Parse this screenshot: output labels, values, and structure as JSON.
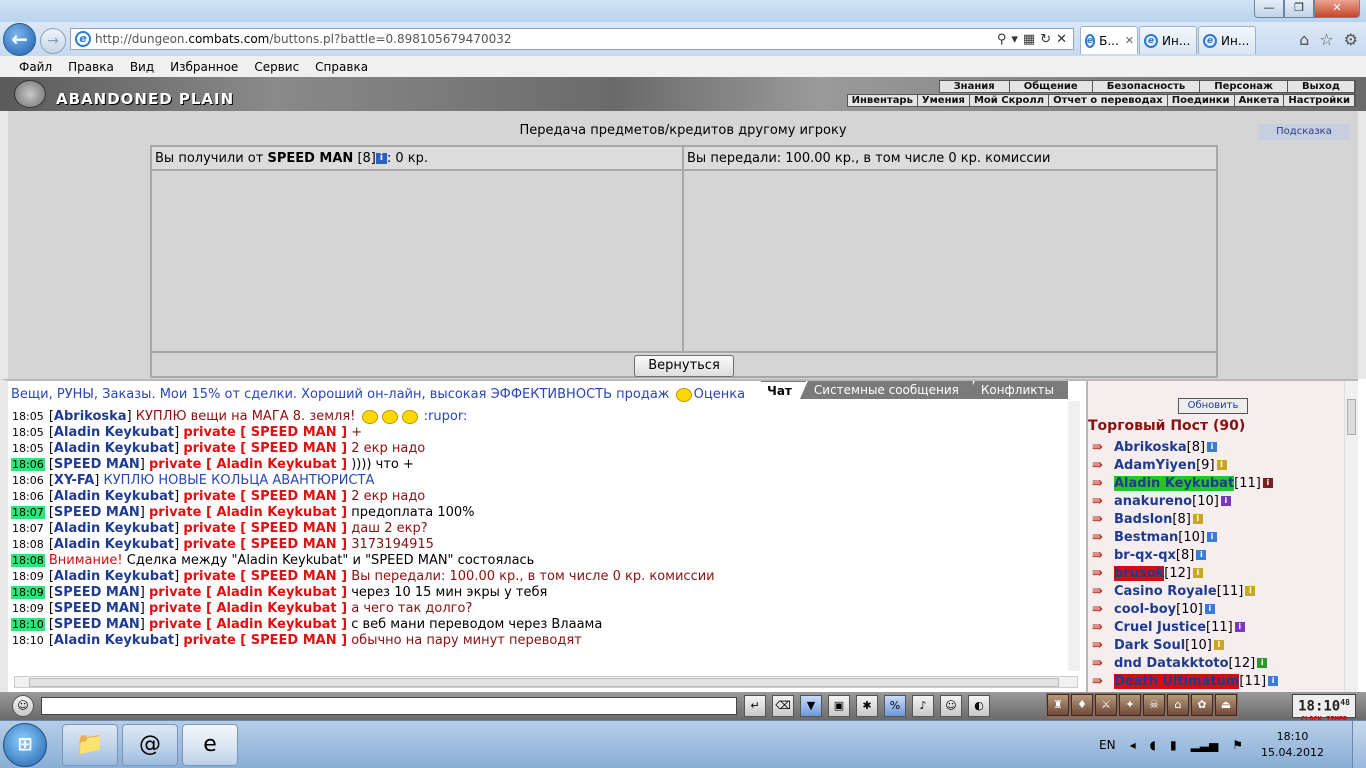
{
  "browser": {
    "url_prefix": "http://dungeon.",
    "url_host": "combats.com",
    "url_suffix": "/buttons.pl?battle=0.898105679470032",
    "tabs": [
      {
        "label": "Б...",
        "close": "✕"
      },
      {
        "label": "Ин..."
      },
      {
        "label": "Ин..."
      }
    ],
    "window_min": "—",
    "window_max": "❐",
    "window_close": "✕"
  },
  "menu": [
    "Файл",
    "Правка",
    "Вид",
    "Избранное",
    "Сервис",
    "Справка"
  ],
  "game": {
    "logo": "ABANDONED PLAIN",
    "nav_top": [
      "Знания",
      "Общение",
      "Безопасность",
      "Персонаж",
      "Выход"
    ],
    "nav_bottom": [
      "Инвентарь",
      "Умения",
      "Мой Скролл",
      "Отчет о переводах",
      "Поединки",
      "Анкета",
      "Настройки"
    ]
  },
  "transfer": {
    "heading": "Передача предметов/кредитов другому игроку",
    "hint": "Подсказка",
    "received_prefix": "Вы получили от ",
    "received_name": "SPEED MAN",
    "received_level": " [8]",
    "received_suffix": ": 0 кр.",
    "given": "Вы передали: 100.00 кр., в том числе 0 кр. комиссии",
    "back_button": "Вернуться"
  },
  "chat": {
    "advert": "Вещи, РУНЫ, Заказы. Мои 15% от сделки. Хороший он-лайн, высокая ЭФФЕКТИВНОСТЬ продаж",
    "advert_tail": "Оценка",
    "tabs": [
      "Чат",
      "Системные сообщения",
      "Конфликты"
    ],
    "lines": [
      {
        "time": "18:05",
        "hl": false,
        "nick": "Abrikoska",
        "priv": "",
        "msg": "КУПЛЮ вещи на МАГА 8. земля!",
        "style": "red",
        "tail": ":rupor:"
      },
      {
        "time": "18:05",
        "hl": false,
        "nick": "Aladin Keykubat",
        "priv": "private [ SPEED MAN ]",
        "msg": "+",
        "style": "red"
      },
      {
        "time": "18:05",
        "hl": false,
        "nick": "Aladin Keykubat",
        "priv": "private [ SPEED MAN ]",
        "msg": "2 екр надо",
        "style": "red"
      },
      {
        "time": "18:06",
        "hl": true,
        "nick": "SPEED MAN",
        "priv": "private [ Aladin Keykubat ]",
        "msg": ")))) что +",
        "style": ""
      },
      {
        "time": "18:06",
        "hl": false,
        "nick": "XY-FA",
        "priv": "",
        "msg": "КУПЛЮ НОВЫЕ КОЛЬЦА АВАНТЮРИСТА",
        "style": "blue"
      },
      {
        "time": "18:06",
        "hl": false,
        "nick": "Aladin Keykubat",
        "priv": "private [ SPEED MAN ]",
        "msg": "2 екр надо",
        "style": "red"
      },
      {
        "time": "18:07",
        "hl": true,
        "nick": "SPEED MAN",
        "priv": "private [ Aladin Keykubat ]",
        "msg": "предоплата 100%",
        "style": ""
      },
      {
        "time": "18:07",
        "hl": false,
        "nick": "Aladin Keykubat",
        "priv": "private [ SPEED MAN ]",
        "msg": "даш 2 екр?",
        "style": "red"
      },
      {
        "time": "18:08",
        "hl": false,
        "nick": "Aladin Keykubat",
        "priv": "private [ SPEED MAN ]",
        "msg": "3173194915",
        "style": "red"
      },
      {
        "time": "18:08",
        "hl": true,
        "warn": "Внимание!",
        "msg": "Сделка между \"Aladin Keykubat\" и \"SPEED MAN\" состоялась",
        "style": ""
      },
      {
        "time": "18:09",
        "hl": false,
        "nick": "Aladin Keykubat",
        "priv": "private [ SPEED MAN ]",
        "msg": "Вы передали: 100.00 кр., в том числе 0 кр. комиссии",
        "style": "red"
      },
      {
        "time": "18:09",
        "hl": true,
        "nick": "SPEED MAN",
        "priv": "private [ Aladin Keykubat ]",
        "msg": "через 10 15 мин экры у тебя",
        "style": ""
      },
      {
        "time": "18:09",
        "hl": false,
        "nick": "SPEED MAN",
        "priv": "private [ Aladin Keykubat ]",
        "msg": "а чего так долго?",
        "style": "red"
      },
      {
        "time": "18:10",
        "hl": true,
        "nick": "SPEED MAN",
        "priv": "private [ Aladin Keykubat ]",
        "msg": "с веб мани переводом через Влаама",
        "style": ""
      },
      {
        "time": "18:10",
        "hl": false,
        "nick": "Aladin Keykubat",
        "priv": "private [ SPEED MAN ]",
        "msg": "обычно на пару минут переводят",
        "style": "red"
      }
    ]
  },
  "online": {
    "refresh": "Обновить",
    "room": "Торговый Пост (90)",
    "players": [
      {
        "name": "Abrikoska",
        "level": "[8]",
        "badge": "b-blue",
        "style": ""
      },
      {
        "name": "AdamYiyen",
        "level": "[9]",
        "badge": "b-yel",
        "style": ""
      },
      {
        "name": "Aladin Keykubat",
        "level": "[11]",
        "badge": "b-dark",
        "style": "green"
      },
      {
        "name": "anakureno",
        "level": "[10]",
        "badge": "b-pur",
        "style": ""
      },
      {
        "name": "Badslon",
        "level": "[8]",
        "badge": "b-yel",
        "style": ""
      },
      {
        "name": "Bestman",
        "level": "[10]",
        "badge": "b-blue",
        "style": ""
      },
      {
        "name": "br-qx-qx",
        "level": "[8]",
        "badge": "b-blue",
        "style": ""
      },
      {
        "name": "brusok",
        "level": "[12]",
        "badge": "b-yel",
        "style": "red"
      },
      {
        "name": "Casino Royale",
        "level": "[11]",
        "badge": "b-yel",
        "style": ""
      },
      {
        "name": "cool-boy",
        "level": "[10]",
        "badge": "b-blue",
        "style": ""
      },
      {
        "name": "Cruel Justice",
        "level": "[11]",
        "badge": "b-pur",
        "style": ""
      },
      {
        "name": "Dark Soul",
        "level": "[10]",
        "badge": "b-yel",
        "style": ""
      },
      {
        "name": "dnd Datakktoto",
        "level": "[12]",
        "badge": "b-grn",
        "style": ""
      },
      {
        "name": "Death Ultimatum",
        "level": "[11]",
        "badge": "b-blue",
        "style": "red"
      }
    ]
  },
  "clock": {
    "time": "18:10",
    "sec": "48",
    "label": "CLOCK TIMER"
  },
  "taskbar": {
    "lang": "EN",
    "time": "18:10",
    "date": "15.04.2012"
  }
}
